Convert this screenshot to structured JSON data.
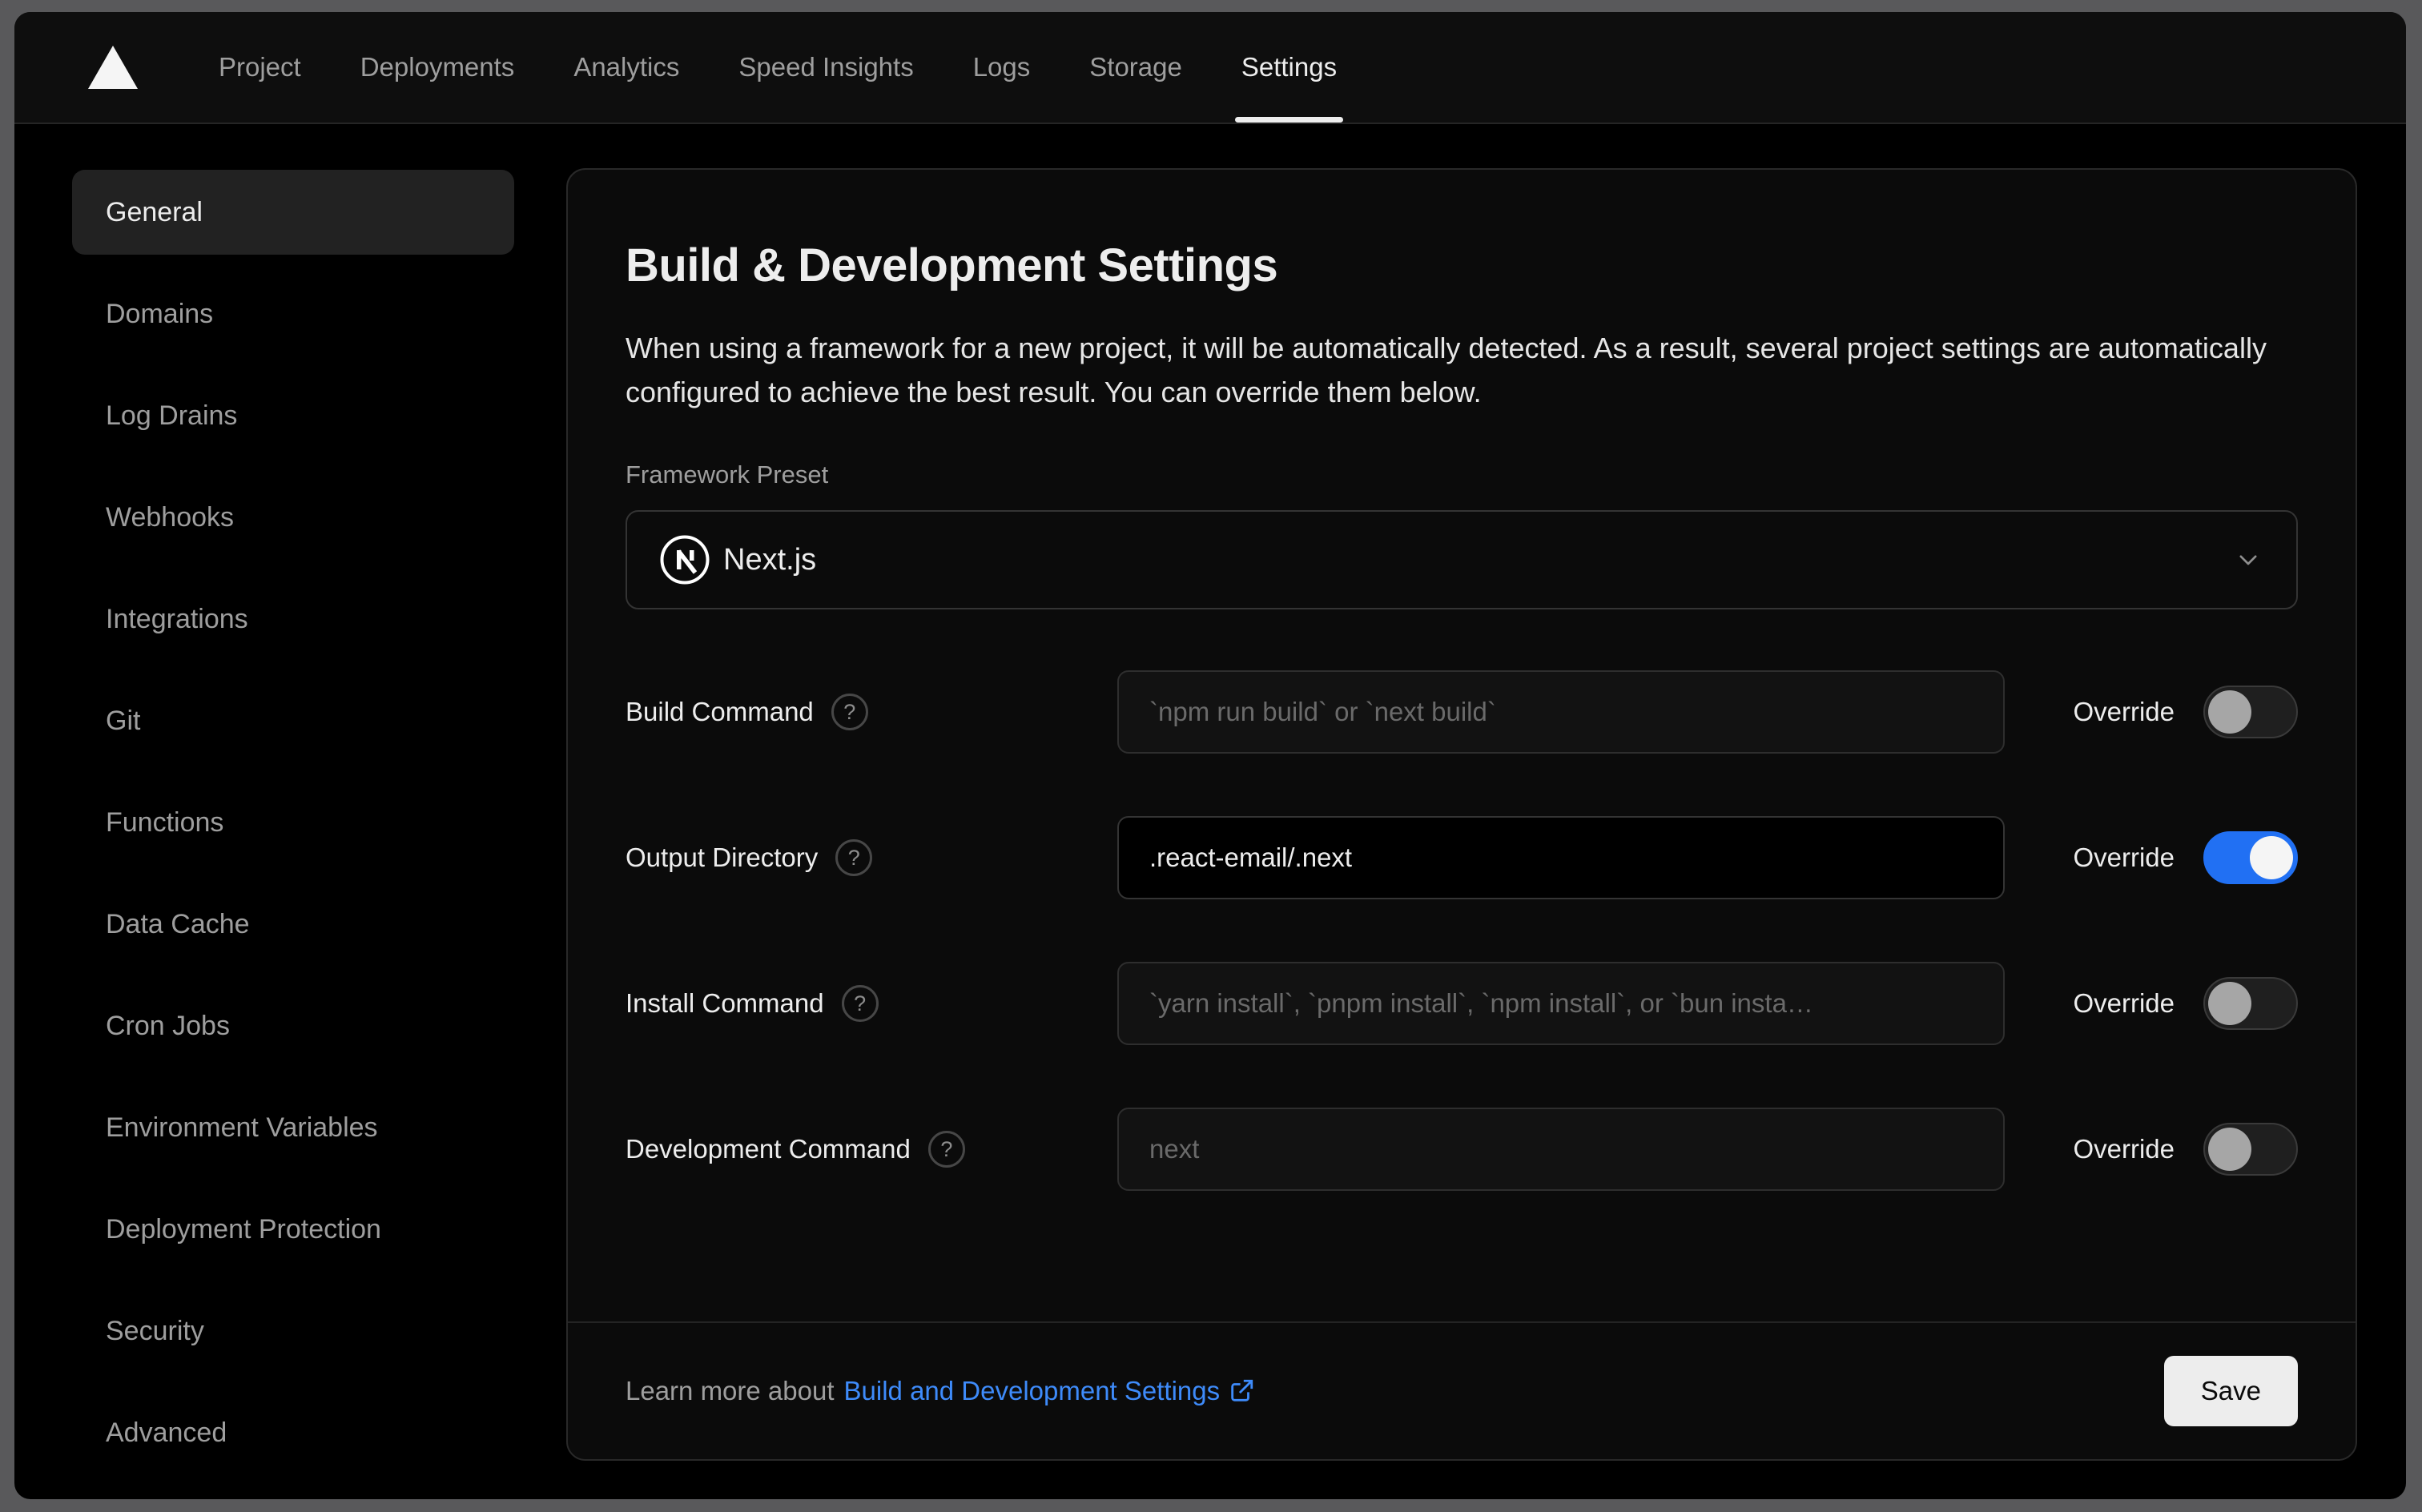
{
  "nav": {
    "tabs": [
      {
        "label": "Project",
        "active": false
      },
      {
        "label": "Deployments",
        "active": false
      },
      {
        "label": "Analytics",
        "active": false
      },
      {
        "label": "Speed Insights",
        "active": false
      },
      {
        "label": "Logs",
        "active": false
      },
      {
        "label": "Storage",
        "active": false
      },
      {
        "label": "Settings",
        "active": true
      }
    ]
  },
  "sidebar": {
    "items": [
      {
        "label": "General",
        "active": true
      },
      {
        "label": "Domains",
        "active": false
      },
      {
        "label": "Log Drains",
        "active": false
      },
      {
        "label": "Webhooks",
        "active": false
      },
      {
        "label": "Integrations",
        "active": false
      },
      {
        "label": "Git",
        "active": false
      },
      {
        "label": "Functions",
        "active": false
      },
      {
        "label": "Data Cache",
        "active": false
      },
      {
        "label": "Cron Jobs",
        "active": false
      },
      {
        "label": "Environment Variables",
        "active": false
      },
      {
        "label": "Deployment Protection",
        "active": false
      },
      {
        "label": "Security",
        "active": false
      },
      {
        "label": "Advanced",
        "active": false
      }
    ]
  },
  "main": {
    "title": "Build & Development Settings",
    "description": "When using a framework for a new project, it will be automatically detected. As a result, several project settings are automatically configured to achieve the best result. You can override them below.",
    "framework": {
      "label": "Framework Preset",
      "value": "Next.js"
    },
    "override_label": "Override",
    "rows": [
      {
        "label": "Build Command",
        "placeholder": "`npm run build` or `next build`",
        "value": "",
        "override": false
      },
      {
        "label": "Output Directory",
        "placeholder": "",
        "value": ".react-email/.next",
        "override": true
      },
      {
        "label": "Install Command",
        "placeholder": "`yarn install`, `pnpm install`, `npm install`, or `bun insta…",
        "value": "",
        "override": false
      },
      {
        "label": "Development Command",
        "placeholder": "next",
        "value": "",
        "override": false
      }
    ],
    "footer": {
      "text": "Learn more about",
      "link": "Build and Development Settings",
      "save": "Save"
    }
  },
  "icons": {
    "help": "?"
  },
  "colors": {
    "accent_blue_toggle": "#2170f3",
    "link_blue": "#3e8bfa",
    "card_bg": "#0b0b0b",
    "page_bg": "#000000",
    "chrome_gray": "#59595b",
    "active_item_bg": "#222222",
    "muted_text": "#9e9e9e",
    "primary_text": "#ededed"
  }
}
